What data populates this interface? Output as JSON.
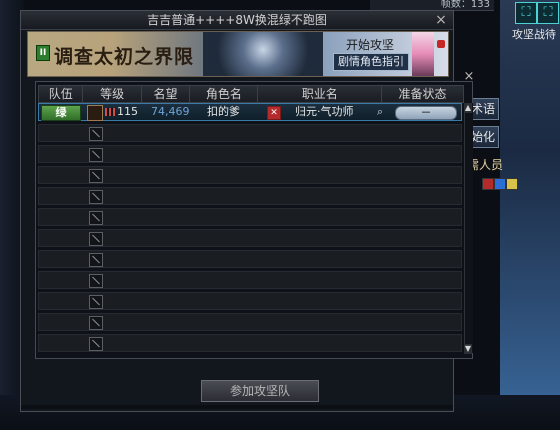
{
  "top_bar": {
    "text": "帧数：133"
  },
  "pvp": {
    "label": "攻坚战待"
  },
  "window": {
    "title": "吉吉普通++++8W换混绿不跑图",
    "close_label": "×"
  },
  "banner": {
    "badge": "II",
    "title": "调查太初之界限",
    "start_label": "开始攻坚",
    "guide_label": "剧情角色指引"
  },
  "table": {
    "headers": [
      "队伍",
      "等级",
      "名望",
      "角色名",
      "职业名",
      "准备状态"
    ],
    "rows": [
      {
        "group": "绿",
        "level": "115",
        "fame": "74,469",
        "name": "扣的爹",
        "class_name": "归元·气功师",
        "ready": "－"
      }
    ],
    "empty_rows": 11
  },
  "side_buttons": {
    "skill": "技术语",
    "init": "初始化",
    "needed_label": "所需人员"
  },
  "join_button": {
    "label": "参加攻坚队"
  },
  "colors": {
    "group_badge": "#5ea34d",
    "fame": "#6ea4d8"
  },
  "icons": {
    "close": "close-icon",
    "lock": "lock-icon",
    "search": "search-icon",
    "class": "class-icon",
    "scroll_up": "chevron-up-icon",
    "scroll_down": "chevron-down-icon"
  }
}
